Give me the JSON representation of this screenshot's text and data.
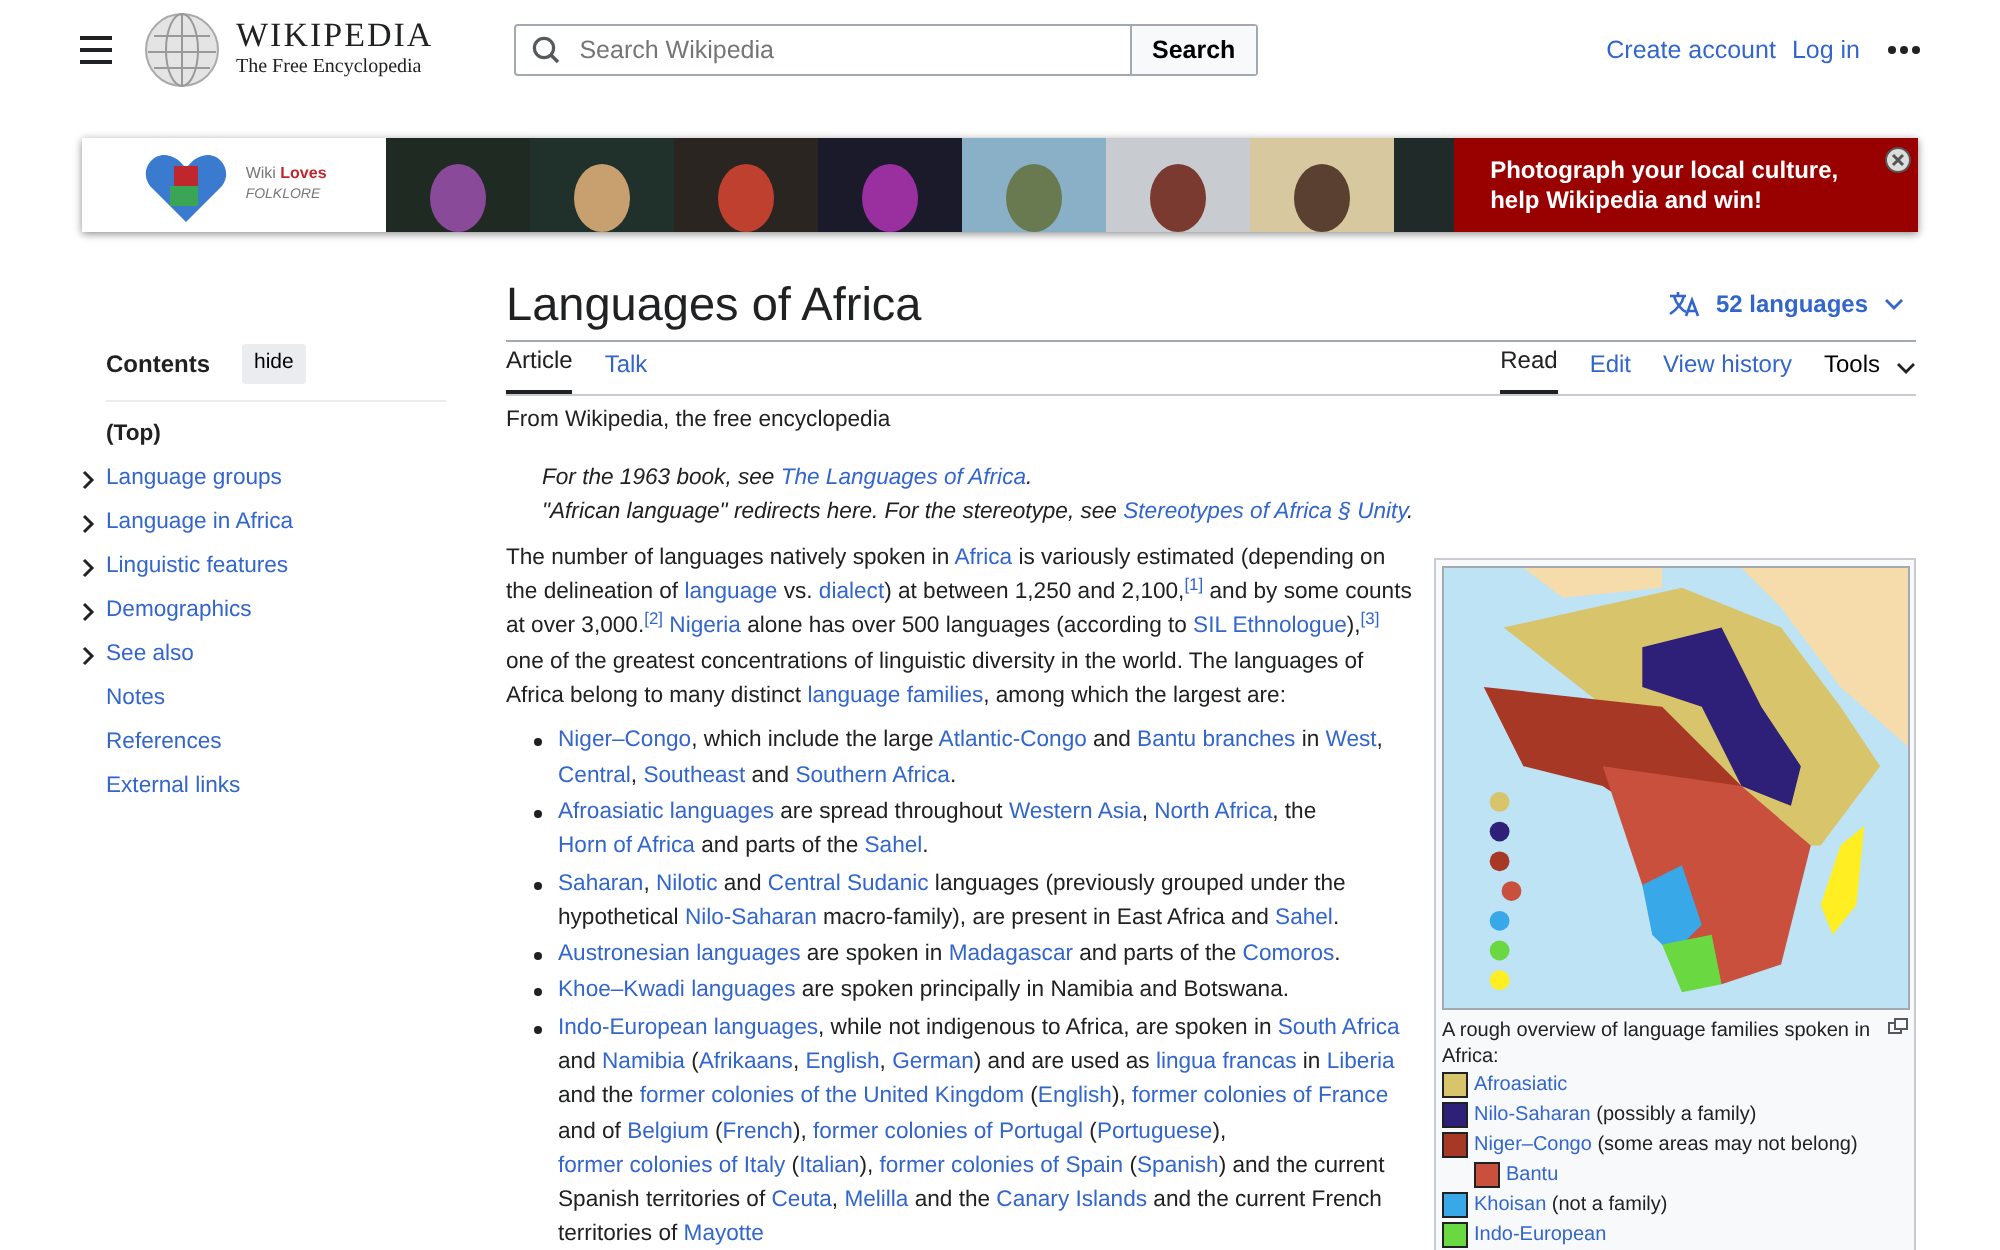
{
  "header": {
    "wordmark": "WIKIPEDIA",
    "tagline": "The Free Encyclopedia",
    "search": {
      "placeholder": "Search Wikipedia",
      "button": "Search"
    },
    "links": [
      "Create account",
      "Log in"
    ]
  },
  "banner": {
    "logo_line1_a": "Wiki ",
    "logo_line1_b": "Loves",
    "logo_line2": "FOLKLORE",
    "message": "Photograph your local culture, help Wikipedia and win!"
  },
  "sidebar": {
    "title": "Contents",
    "hide_button": "hide",
    "items": [
      {
        "label": "(Top)",
        "kind": "top"
      },
      {
        "label": "Language groups",
        "kind": "collapsible"
      },
      {
        "label": "Language in Africa",
        "kind": "collapsible"
      },
      {
        "label": "Linguistic features",
        "kind": "collapsible"
      },
      {
        "label": "Demographics",
        "kind": "collapsible"
      },
      {
        "label": "See also",
        "kind": "collapsible"
      },
      {
        "label": "Notes",
        "kind": "plain"
      },
      {
        "label": "References",
        "kind": "plain"
      },
      {
        "label": "External links",
        "kind": "plain"
      }
    ]
  },
  "article": {
    "title": "Languages of Africa",
    "languages_button": "52 languages",
    "tabs_left": [
      {
        "label": "Article",
        "selected": true
      },
      {
        "label": "Talk",
        "selected": false
      }
    ],
    "tabs_right": [
      {
        "label": "Read",
        "selected": true,
        "kind": "tab"
      },
      {
        "label": "Edit",
        "selected": false,
        "kind": "tab"
      },
      {
        "label": "View history",
        "selected": false,
        "kind": "tab"
      },
      {
        "label": "Tools",
        "selected": false,
        "kind": "dropdown"
      }
    ],
    "tagline": "From Wikipedia, the free encyclopedia",
    "hatnotes": [
      [
        {
          "text": "For the 1963 book, see ",
          "link": false
        },
        {
          "text": "The Languages of Africa",
          "link": true
        },
        {
          "text": ".",
          "link": false
        }
      ],
      [
        {
          "text": "\"African language\" redirects here. For the stereotype, see ",
          "link": false
        },
        {
          "text": "Stereotypes of Africa § Unity",
          "link": true
        },
        {
          "text": ".",
          "link": false
        }
      ]
    ],
    "intro": [
      {
        "text": "The number of languages natively spoken in ",
        "link": false
      },
      {
        "text": "Africa",
        "link": true
      },
      {
        "text": " is variously estimated (depending on the delineation of ",
        "link": false
      },
      {
        "text": "language",
        "link": true
      },
      {
        "text": " vs. ",
        "link": false
      },
      {
        "text": "dialect",
        "link": true
      },
      {
        "text": ") at between 1,250 and 2,100,",
        "link": false
      },
      {
        "text": "$^{[1]}$",
        "link": true
      },
      {
        "text": " and by some counts at over 3,000.",
        "link": false
      },
      {
        "text": "$^{[2]}$ ",
        "link": true
      },
      {
        "text": "Nigeria",
        "link": true
      },
      {
        "text": " alone has over 500 languages (according to ",
        "link": false
      },
      {
        "text": "SIL Ethnologue",
        "link": true
      },
      {
        "text": "),",
        "link": false
      },
      {
        "text": "$^{[3]}$",
        "link": true
      },
      {
        "text": " one of the greatest concentrations of linguistic diversity in the world. The languages of Africa belong to many distinct ",
        "link": false
      },
      {
        "text": "language families",
        "link": true
      },
      {
        "text": ", among which the largest are:",
        "link": false
      }
    ],
    "bullets": [
      [
        {
          "text": "Niger–Congo",
          "link": true
        },
        {
          "text": ", which include the large ",
          "link": false
        },
        {
          "text": "Atlantic-Congo",
          "link": true
        },
        {
          "text": " and ",
          "link": false
        },
        {
          "text": "Bantu branches",
          "link": true
        },
        {
          "text": " in ",
          "link": false
        },
        {
          "text": "West",
          "link": true
        },
        {
          "text": ", ",
          "link": false
        },
        {
          "text": "Central",
          "link": true
        },
        {
          "text": ", ",
          "link": false
        },
        {
          "text": "Southeast",
          "link": true
        },
        {
          "text": " and ",
          "link": false
        },
        {
          "text": "Southern Africa",
          "link": true
        },
        {
          "text": ".",
          "link": false
        }
      ],
      [
        {
          "text": "Afroasiatic languages",
          "link": true
        },
        {
          "text": " are spread throughout ",
          "link": false
        },
        {
          "text": "Western Asia",
          "link": true
        },
        {
          "text": ", ",
          "link": false
        },
        {
          "text": "North Africa",
          "link": true
        },
        {
          "text": ", the ",
          "link": false
        },
        {
          "text": "Horn of Africa",
          "link": true
        },
        {
          "text": " and parts of the ",
          "link": false
        },
        {
          "text": "Sahel",
          "link": true
        },
        {
          "text": ".",
          "link": false
        }
      ],
      [
        {
          "text": "Saharan",
          "link": true
        },
        {
          "text": ", ",
          "link": false
        },
        {
          "text": "Nilotic",
          "link": true
        },
        {
          "text": " and ",
          "link": false
        },
        {
          "text": "Central Sudanic",
          "link": true
        },
        {
          "text": " languages (previously grouped under the hypothetical ",
          "link": false
        },
        {
          "text": "Nilo-Saharan",
          "link": true
        },
        {
          "text": " macro-family), are present in East Africa and ",
          "link": false
        },
        {
          "text": "Sahel",
          "link": true
        },
        {
          "text": ".",
          "link": false
        }
      ],
      [
        {
          "text": "Austronesian languages",
          "link": true
        },
        {
          "text": " are spoken in ",
          "link": false
        },
        {
          "text": "Madagascar",
          "link": true
        },
        {
          "text": " and parts of the ",
          "link": false
        },
        {
          "text": "Comoros",
          "link": true
        },
        {
          "text": ".",
          "link": false
        }
      ],
      [
        {
          "text": "Khoe–Kwadi languages",
          "link": true
        },
        {
          "text": " are spoken principally in Namibia and Botswana.",
          "link": false
        }
      ],
      [
        {
          "text": "Indo-European languages",
          "link": true
        },
        {
          "text": ", while not indigenous to Africa, are spoken in ",
          "link": false
        },
        {
          "text": "South Africa",
          "link": true
        },
        {
          "text": " and ",
          "link": false
        },
        {
          "text": "Namibia",
          "link": true
        },
        {
          "text": " (",
          "link": false
        },
        {
          "text": "Afrikaans",
          "link": true
        },
        {
          "text": ", ",
          "link": false
        },
        {
          "text": "English",
          "link": true
        },
        {
          "text": ", ",
          "link": false
        },
        {
          "text": "German",
          "link": true
        },
        {
          "text": ") and are used as ",
          "link": false
        },
        {
          "text": "lingua francas",
          "link": true
        },
        {
          "text": " in ",
          "link": false
        },
        {
          "text": "Liberia",
          "link": true
        },
        {
          "text": " and the ",
          "link": false
        },
        {
          "text": "former colonies of the United Kingdom",
          "link": true
        },
        {
          "text": " (",
          "link": false
        },
        {
          "text": "English",
          "link": true
        },
        {
          "text": "), ",
          "link": false
        },
        {
          "text": "former colonies of France",
          "link": true
        },
        {
          "text": " and of ",
          "link": false
        },
        {
          "text": "Belgium",
          "link": true
        },
        {
          "text": " (",
          "link": false
        },
        {
          "text": "French",
          "link": true
        },
        {
          "text": "), ",
          "link": false
        },
        {
          "text": "former colonies of Portugal",
          "link": true
        },
        {
          "text": " (",
          "link": false
        },
        {
          "text": "Portuguese",
          "link": true
        },
        {
          "text": "), ",
          "link": false
        },
        {
          "text": "former colonies of Italy",
          "link": true
        },
        {
          "text": " (",
          "link": false
        },
        {
          "text": "Italian",
          "link": true
        },
        {
          "text": "), ",
          "link": false
        },
        {
          "text": "former colonies of Spain",
          "link": true
        },
        {
          "text": " (",
          "link": false
        },
        {
          "text": "Spanish",
          "link": true
        },
        {
          "text": ") and the current Spanish territories of ",
          "link": false
        },
        {
          "text": "Ceuta",
          "link": true
        },
        {
          "text": ", ",
          "link": false
        },
        {
          "text": "Melilla",
          "link": true
        },
        {
          "text": " and the ",
          "link": false
        },
        {
          "text": "Canary Islands",
          "link": true
        },
        {
          "text": " and the current French territories of ",
          "link": false
        },
        {
          "text": "Mayotte",
          "link": true
        }
      ]
    ],
    "infobox": {
      "caption": "A rough overview of language families spoken in Africa:",
      "legend": [
        {
          "label": "Afroasiatic",
          "color": "#d8c46a"
        },
        {
          "label": "Nilo-Saharan",
          "note": " (possibly a family)",
          "color": "#2e1f78"
        },
        {
          "label": "Niger–Congo",
          "note": " (some areas may not belong)",
          "color": "#a83826",
          "children": [
            {
              "label": "Bantu",
              "color": "#c8503c"
            }
          ]
        },
        {
          "label": "Khoisan",
          "note": " (not a family)",
          "color": "#38a8e8"
        },
        {
          "label": "Indo-European",
          "color": "#6ad840"
        }
      ]
    }
  }
}
